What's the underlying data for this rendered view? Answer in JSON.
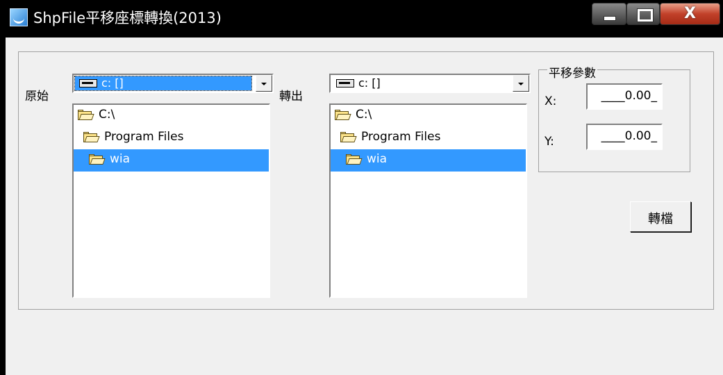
{
  "window": {
    "title": "ShpFile平移座標轉換(2013)",
    "close_glyph": "X"
  },
  "source": {
    "label": "原始",
    "drive": "c: []",
    "dirs": [
      {
        "name": "C:\\",
        "selected": false
      },
      {
        "name": "Program Files",
        "selected": false
      },
      {
        "name": "wia",
        "selected": true
      }
    ]
  },
  "output": {
    "label": "轉出",
    "drive": "c: []",
    "dirs": [
      {
        "name": "C:\\",
        "selected": false
      },
      {
        "name": "Program Files",
        "selected": false
      },
      {
        "name": "wia",
        "selected": true
      }
    ]
  },
  "params": {
    "legend": "平移參數",
    "x_label": "X:",
    "x_value": "____0.00_",
    "y_label": "Y:",
    "y_value": "____0.00_"
  },
  "convert_button": "轉檔",
  "colors": {
    "selection": "#3399ff",
    "window_bg": "#f0f0f0",
    "titlebar": "#000000"
  },
  "icons": [
    "app-icon",
    "drive-icon",
    "folder-open-icon",
    "minimize-icon",
    "maximize-icon",
    "close-icon"
  ]
}
